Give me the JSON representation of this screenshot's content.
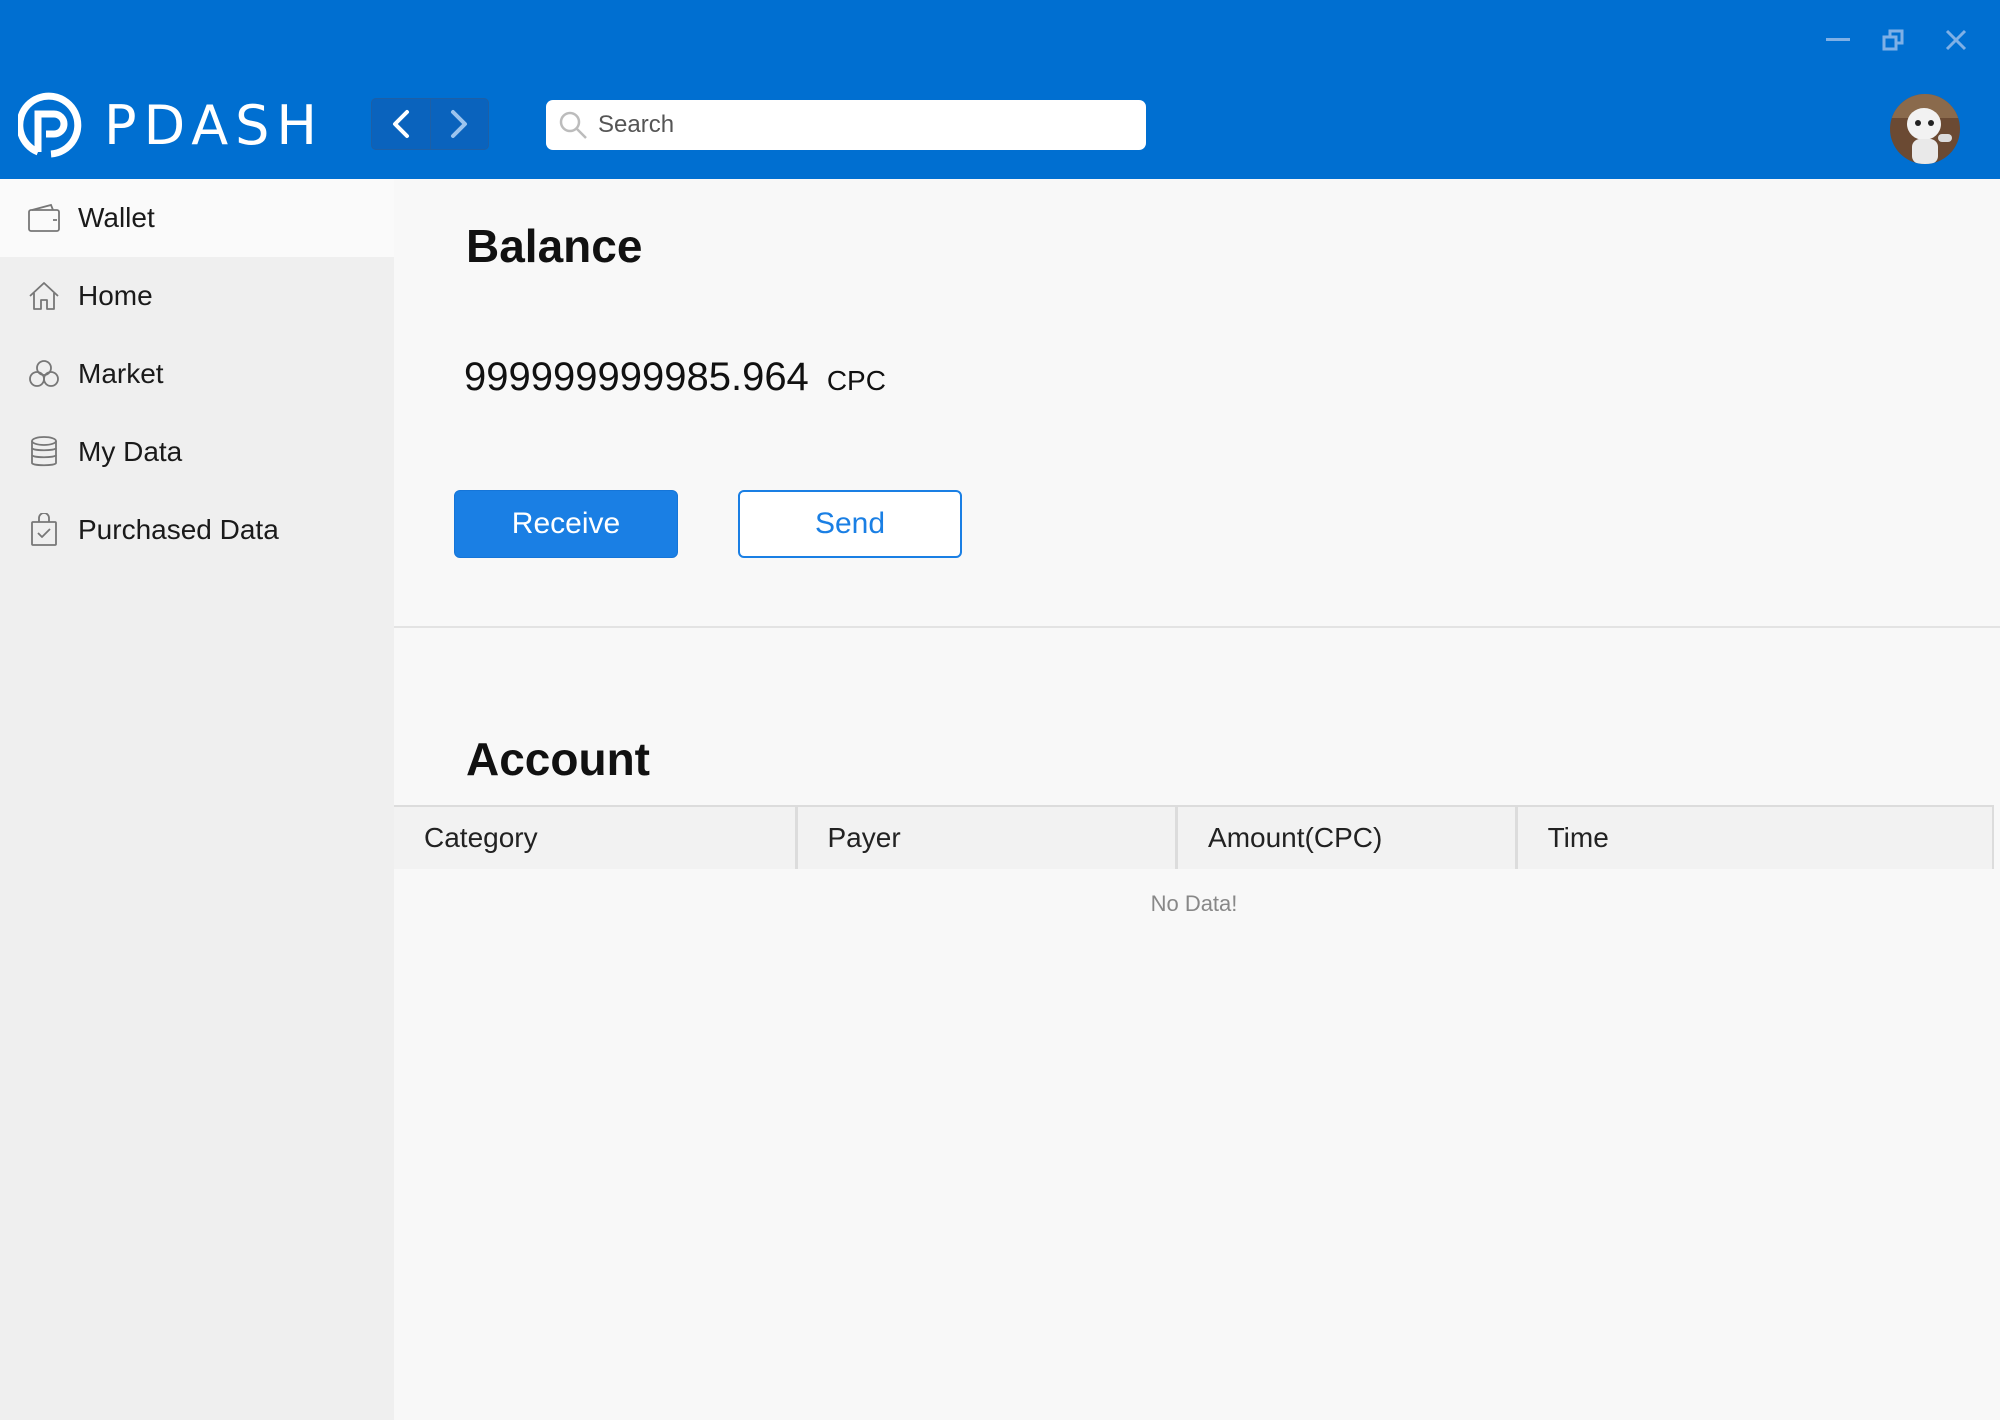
{
  "app": {
    "name": "PDASH"
  },
  "window_controls": {
    "minimize_icon": "minimize-icon",
    "restore_icon": "restore-icon",
    "close_icon": "close-icon"
  },
  "header": {
    "back_icon": "chevron-left-icon",
    "forward_icon": "chevron-right-icon",
    "search": {
      "placeholder": "Search",
      "value": ""
    }
  },
  "sidebar": {
    "items": [
      {
        "label": "Wallet",
        "icon": "wallet-icon",
        "active": true
      },
      {
        "label": "Home",
        "icon": "home-icon",
        "active": false
      },
      {
        "label": "Market",
        "icon": "market-icon",
        "active": false
      },
      {
        "label": "My Data",
        "icon": "database-icon",
        "active": false
      },
      {
        "label": "Purchased Data",
        "icon": "purchased-bag-icon",
        "active": false
      }
    ]
  },
  "balance": {
    "title": "Balance",
    "amount": "999999999985.964",
    "unit": "CPC",
    "receive_label": "Receive",
    "send_label": "Send"
  },
  "account": {
    "title": "Account",
    "columns": [
      "Category",
      "Payer",
      "Amount(CPC)",
      "Time"
    ],
    "rows": [],
    "empty_text": "No Data!"
  },
  "colors": {
    "header_bg": "#006fd1",
    "accent": "#1a7fe4",
    "sidebar_bg": "#efefef",
    "main_bg": "#f8f8f8"
  }
}
